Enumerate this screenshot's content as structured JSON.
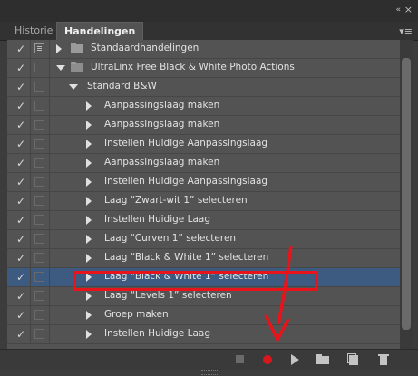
{
  "panel": {
    "collapse_glyph": "«",
    "close_glyph": "×",
    "menu_glyph": "▾≡"
  },
  "tabs": [
    {
      "label": "Historie",
      "active": false
    },
    {
      "label": "Handelingen",
      "active": true
    }
  ],
  "rows": [
    {
      "label": "Standaardhandelingen",
      "level": 0,
      "type": "set",
      "expanded": false,
      "checked": true,
      "dialog": true,
      "selected": false
    },
    {
      "label": "UltraLinx Free Black & White Photo Actions",
      "level": 0,
      "type": "set",
      "expanded": true,
      "checked": true,
      "dialog": false,
      "selected": false
    },
    {
      "label": "Standard B&W",
      "level": 1,
      "type": "action",
      "expanded": true,
      "checked": true,
      "dialog": false,
      "selected": false
    },
    {
      "label": "Aanpassingslaag maken",
      "level": 2,
      "type": "step",
      "expanded": false,
      "checked": true,
      "dialog": false,
      "selected": false
    },
    {
      "label": "Aanpassingslaag maken",
      "level": 2,
      "type": "step",
      "expanded": false,
      "checked": true,
      "dialog": false,
      "selected": false
    },
    {
      "label": "Instellen  Huidige Aanpassingslaag",
      "level": 2,
      "type": "step",
      "expanded": false,
      "checked": true,
      "dialog": false,
      "selected": false
    },
    {
      "label": "Aanpassingslaag maken",
      "level": 2,
      "type": "step",
      "expanded": false,
      "checked": true,
      "dialog": false,
      "selected": false
    },
    {
      "label": "Instellen  Huidige Aanpassingslaag",
      "level": 2,
      "type": "step",
      "expanded": false,
      "checked": true,
      "dialog": false,
      "selected": false
    },
    {
      "label": "Laag “Zwart-wit 1” selecteren",
      "level": 2,
      "type": "step",
      "expanded": false,
      "checked": true,
      "dialog": false,
      "selected": false
    },
    {
      "label": "Instellen  Huidige Laag",
      "level": 2,
      "type": "step",
      "expanded": false,
      "checked": true,
      "dialog": false,
      "selected": false
    },
    {
      "label": "Laag “Curven 1” selecteren",
      "level": 2,
      "type": "step",
      "expanded": false,
      "checked": true,
      "dialog": false,
      "selected": false
    },
    {
      "label": "Laag “Black & White 1” selecteren",
      "level": 2,
      "type": "step",
      "expanded": false,
      "checked": true,
      "dialog": false,
      "selected": false
    },
    {
      "label": "Laag “Black & White 1” selecteren",
      "level": 2,
      "type": "step",
      "expanded": false,
      "checked": true,
      "dialog": false,
      "selected": true
    },
    {
      "label": "Laag “Levels 1” selecteren",
      "level": 2,
      "type": "step",
      "expanded": false,
      "checked": true,
      "dialog": false,
      "selected": false
    },
    {
      "label": "Groep maken",
      "level": 2,
      "type": "step",
      "expanded": false,
      "checked": true,
      "dialog": false,
      "selected": false
    },
    {
      "label": "Instellen  Huidige Laag",
      "level": 2,
      "type": "step",
      "expanded": false,
      "checked": true,
      "dialog": false,
      "selected": false
    }
  ],
  "toolbar": {
    "buttons": [
      "stop-icon",
      "record-icon",
      "play-icon",
      "new-set-icon",
      "new-action-icon",
      "trash-icon"
    ],
    "record_color": "#d8161c"
  },
  "annotation_color": "#e8141b",
  "selection_color": "#3d5a80"
}
